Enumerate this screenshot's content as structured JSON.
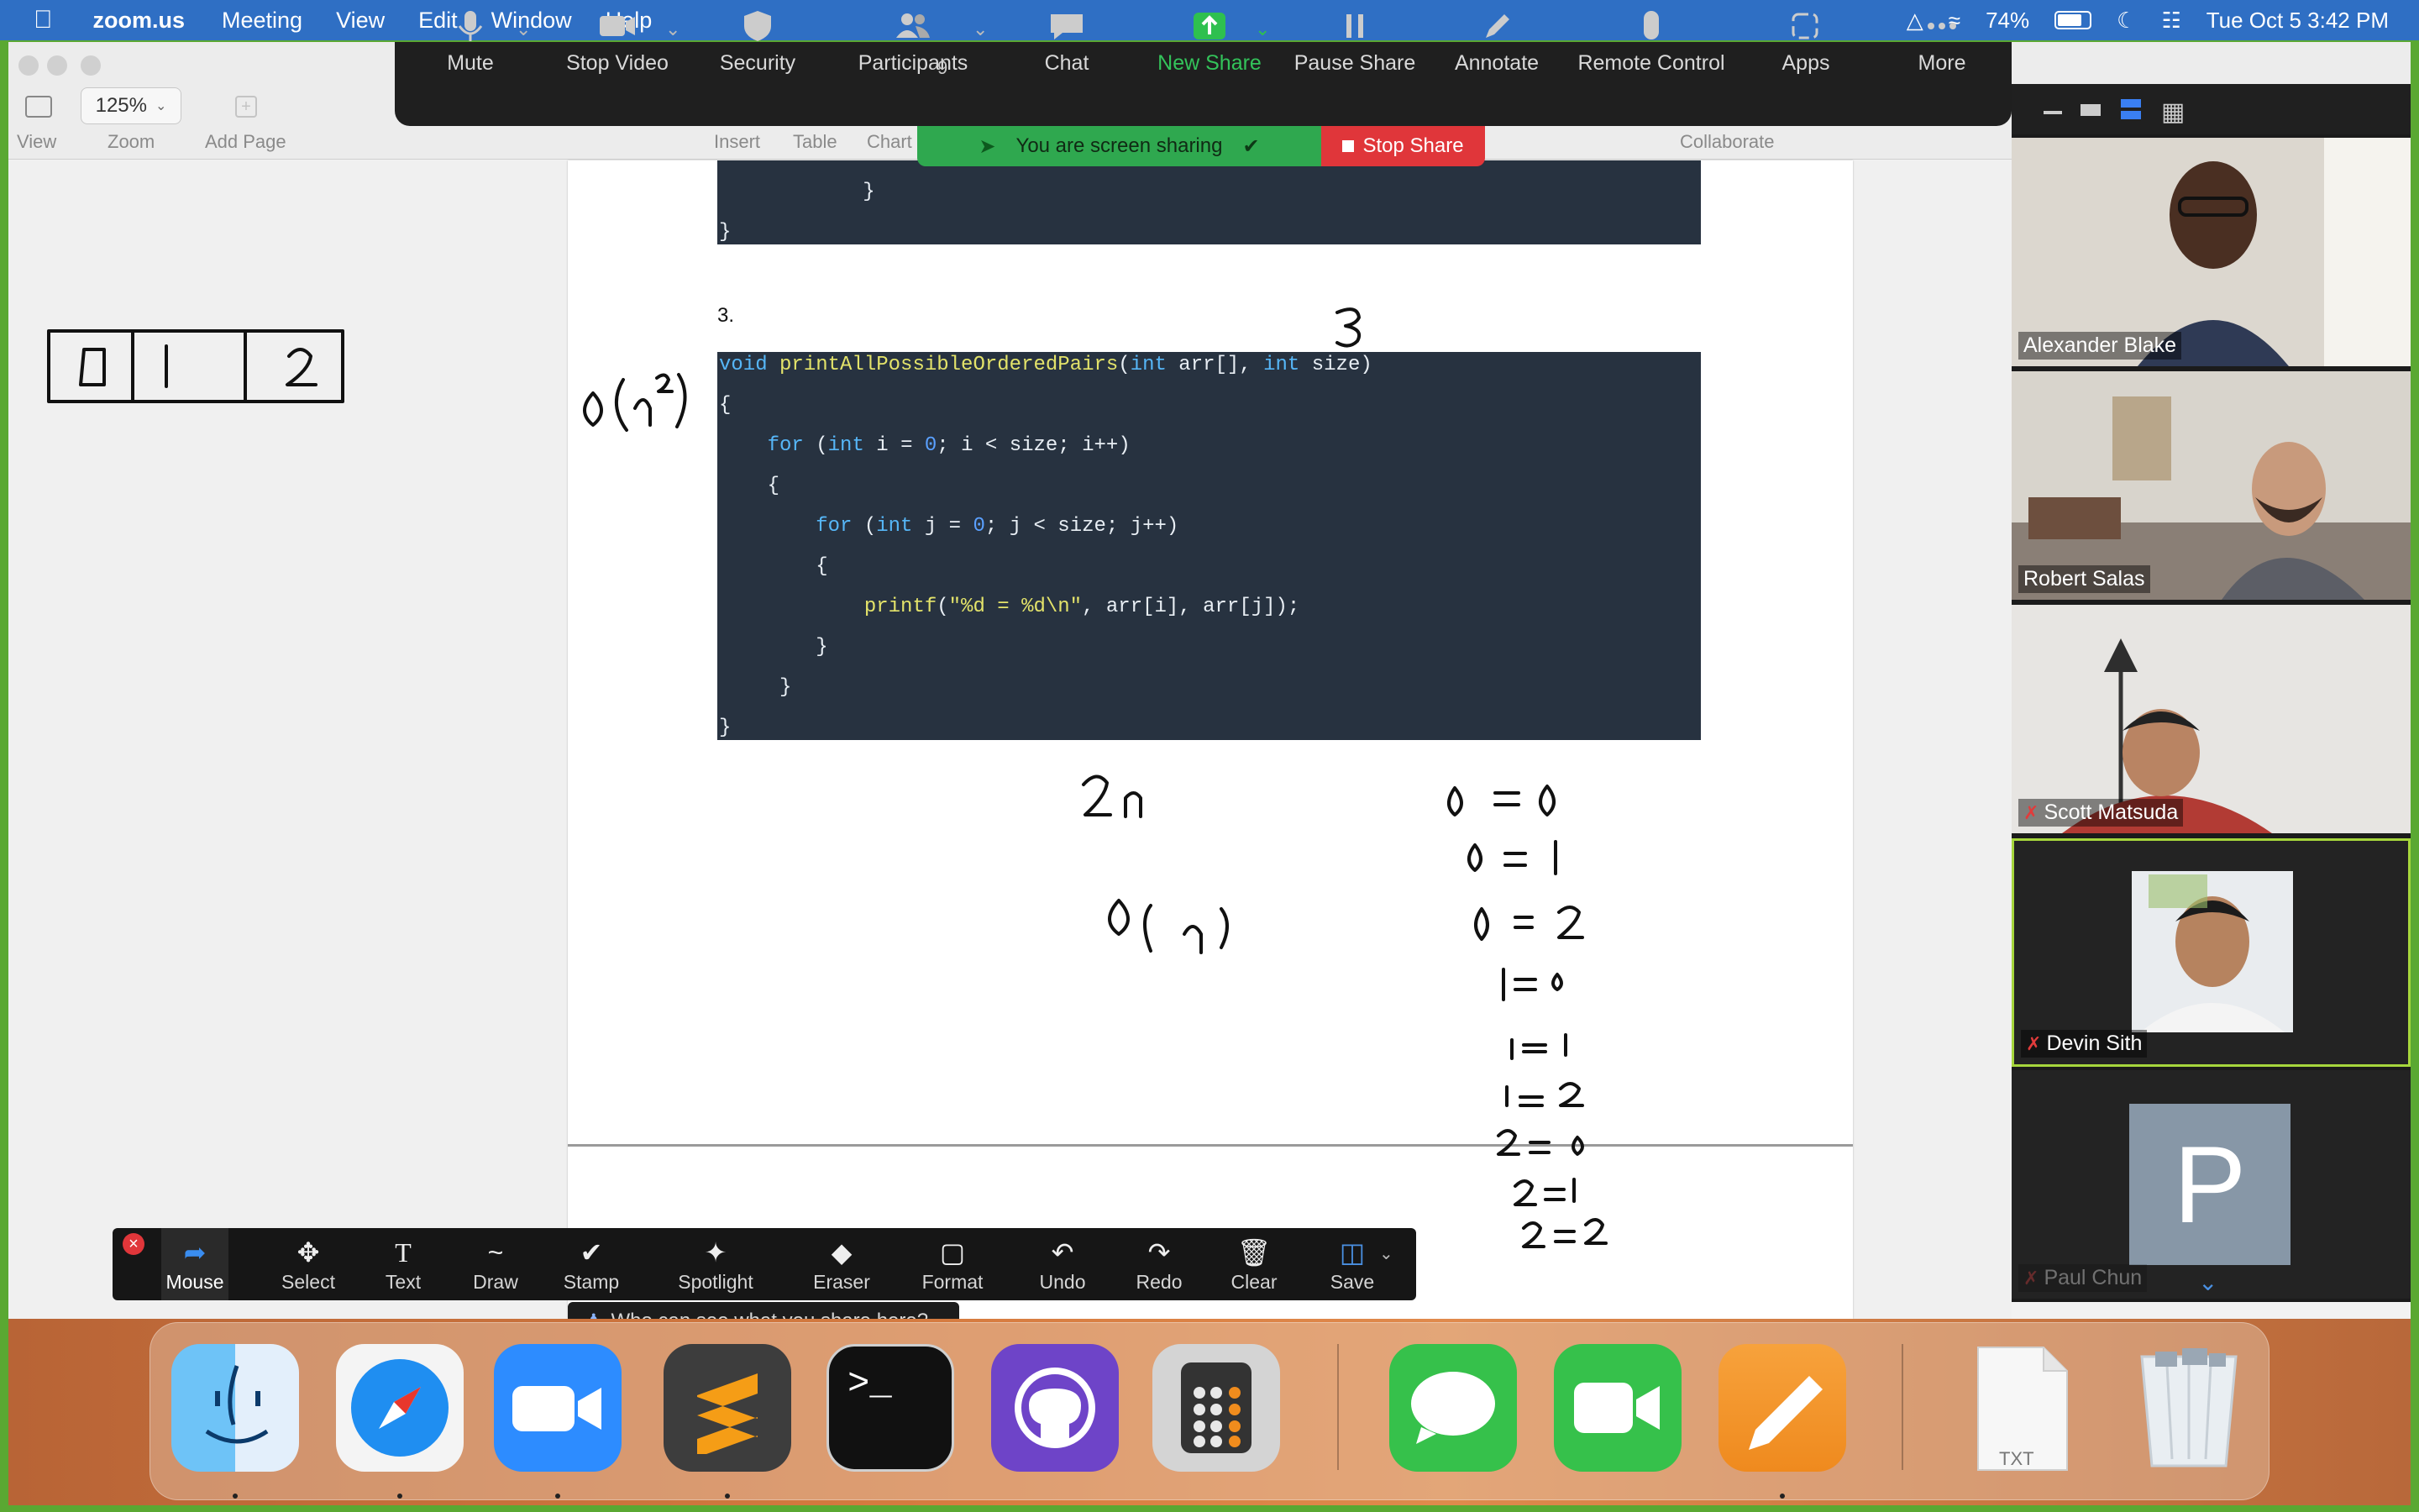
{
  "menubar": {
    "app_name": "zoom.us",
    "items": [
      "Meeting",
      "View",
      "Edit",
      "Window",
      "Help"
    ],
    "battery": "74%",
    "datetime": "Tue Oct 5  3:42 PM"
  },
  "pages_toolbar": {
    "zoom_value": "125%",
    "view_label": "View",
    "zoom_label": "Zoom",
    "add_page_label": "Add Page",
    "insert_label": "Insert",
    "table_label": "Table",
    "chart_label": "Chart",
    "collaborate_label": "Collaborate"
  },
  "zoom_controls": {
    "mute": "Mute",
    "stop_video": "Stop Video",
    "security": "Security",
    "participants": "Participants",
    "participant_count": "9",
    "chat": "Chat",
    "new_share": "New Share",
    "pause_share": "Pause Share",
    "annotate": "Annotate",
    "remote_control": "Remote Control",
    "apps": "Apps",
    "more": "More",
    "sharing_status": "You are screen sharing",
    "stop_share": "Stop Share"
  },
  "document": {
    "item_number": "3.",
    "code_lines": [
      "void printAllPossibleOrderedPairs(int arr[], int size)",
      "{",
      "    for (int i = 0; i < size; i++)",
      "    {",
      "        for (int j = 0; j < size; j++)",
      "        {",
      "            printf(\"%d = %d\\n\", arr[i], arr[j]);",
      "        }",
      "     }",
      "}"
    ],
    "prev_code_tail": [
      "        }",
      "}"
    ]
  },
  "participants": [
    {
      "name": "Alexander Blake",
      "muted": false
    },
    {
      "name": "Robert Salas",
      "muted": false
    },
    {
      "name": "Scott Matsuda",
      "muted": true
    },
    {
      "name": "Devin Sith",
      "muted": true
    },
    {
      "name": "Paul Chun",
      "muted": true,
      "avatar_letter": "P"
    }
  ],
  "annotation_tools": {
    "mouse": "Mouse",
    "select": "Select",
    "text": "Text",
    "draw": "Draw",
    "stamp": "Stamp",
    "spotlight": "Spotlight",
    "eraser": "Eraser",
    "format": "Format",
    "undo": "Undo",
    "redo": "Redo",
    "clear": "Clear",
    "save": "Save",
    "who_can_see": "Who can see what you share here?"
  },
  "dock": {
    "apps": [
      "finder-icon",
      "safari-icon",
      "zoom-icon",
      "sublime-text-icon",
      "terminal-icon",
      "github-desktop-icon",
      "calculator-icon",
      "messages-icon",
      "facetime-icon",
      "pages-icon",
      "txt-file-icon",
      "trash-icon"
    ],
    "txt_label": "TXT"
  },
  "colors": {
    "screen_share_border": "#5aa832",
    "code_background": "#273240",
    "sharing_green": "#2fa84f",
    "stop_red": "#e0363a",
    "new_share_green": "#2ec04f"
  }
}
